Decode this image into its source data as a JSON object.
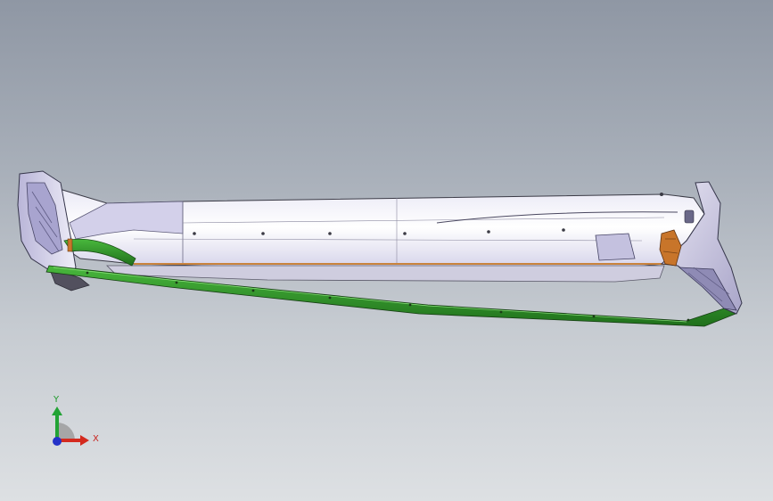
{
  "triad": {
    "y_label": "Y",
    "x_label": "X",
    "colors": {
      "x_axis": "#d42a1e",
      "y_axis": "#22a335",
      "z_axis": "#2432c8"
    }
  },
  "model": {
    "colors": {
      "body_light": "#f4f4fa",
      "body_shade": "#c9c6e2",
      "trim_green": "#2f9a2a",
      "trim_dark": "#1c5f18",
      "bracket_orange": "#c8752a",
      "edge": "#3b3b46"
    }
  }
}
